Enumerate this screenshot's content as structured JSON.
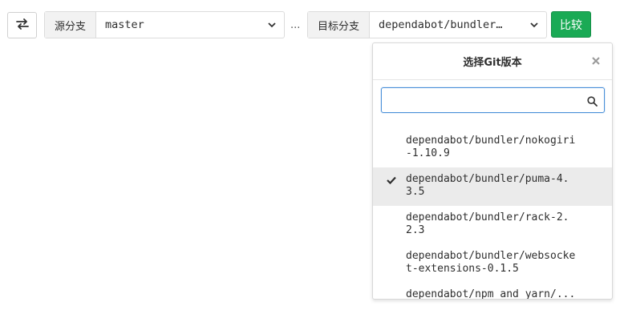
{
  "toolbar": {
    "swap_icon": "swap-arrows-icon",
    "source_label": "源分支",
    "source_value": "master",
    "separator": "...",
    "target_label": "目标分支",
    "target_value": "dependabot/bundler…",
    "compare_label": "比较",
    "accent_color": "#1aaa55"
  },
  "dropdown": {
    "title": "选择Git版本",
    "search_placeholder": "",
    "items": [
      {
        "label": "dependabot/bundler/nokogiri-1.10.9",
        "selected": false
      },
      {
        "label": "dependabot/bundler/puma-4.3.5",
        "selected": true
      },
      {
        "label": "dependabot/bundler/rack-2.2.3",
        "selected": false
      },
      {
        "label": "dependabot/bundler/websocket-extensions-0.1.5",
        "selected": false
      },
      {
        "label": "dependabot/npm_and_yarn/...",
        "selected": false
      }
    ]
  }
}
